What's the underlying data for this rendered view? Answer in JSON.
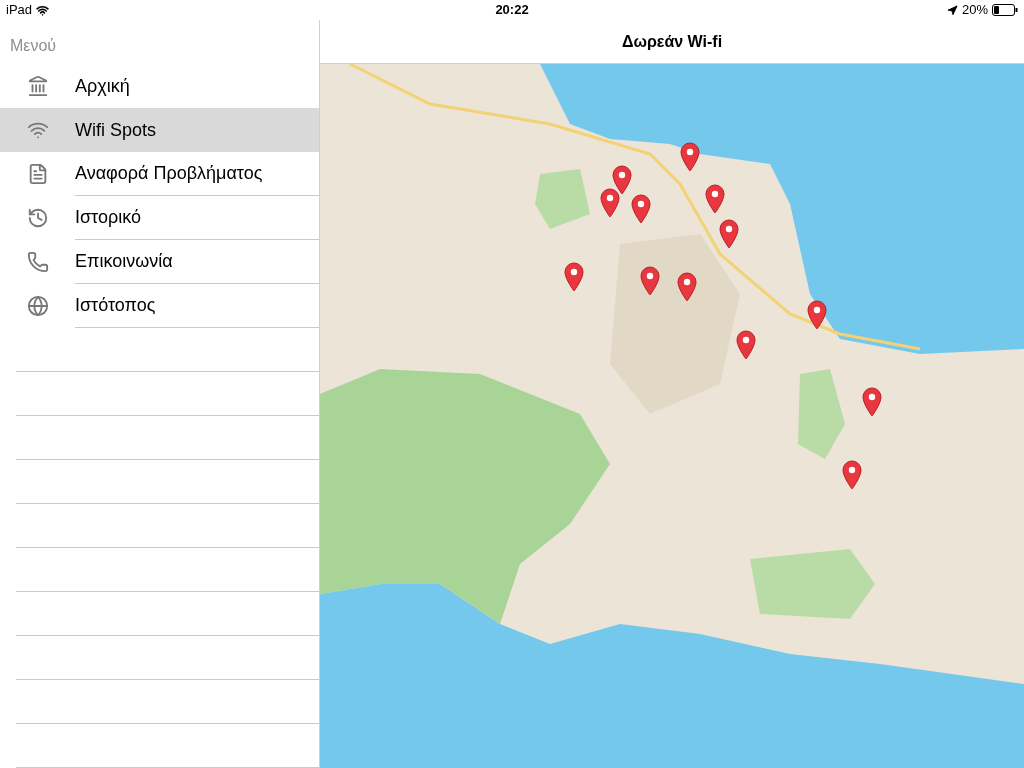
{
  "status_bar": {
    "device": "iPad",
    "time": "20:22",
    "battery": "20%"
  },
  "sidebar": {
    "title": "Μενού",
    "items": [
      {
        "label": "Αρχική",
        "selected": false
      },
      {
        "label": "Wifi Spots",
        "selected": true
      },
      {
        "label": "Αναφορά Προβλήματος",
        "selected": false
      },
      {
        "label": "Ιστορικό",
        "selected": false
      },
      {
        "label": "Επικοινωνία",
        "selected": false
      },
      {
        "label": "Ιστότοπος",
        "selected": false
      }
    ]
  },
  "content": {
    "title": "Δωρεάν Wi-fi"
  }
}
